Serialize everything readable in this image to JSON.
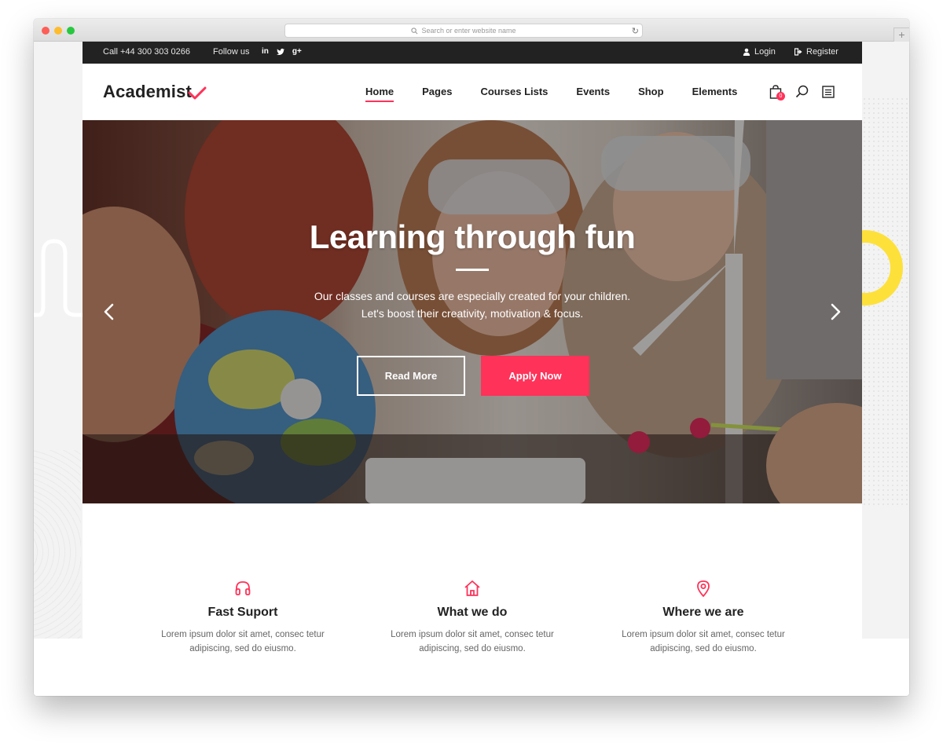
{
  "browser": {
    "url_placeholder": "Search or enter website name",
    "new_tab_label": "+"
  },
  "topbar": {
    "phone": "Call +44 300 303 0266",
    "follow_label": "Follow us",
    "social": [
      "in",
      "▸",
      "g+"
    ],
    "login": "Login",
    "register": "Register"
  },
  "header": {
    "logo": "Academist",
    "nav": [
      {
        "label": "Home",
        "active": true
      },
      {
        "label": "Pages",
        "active": false
      },
      {
        "label": "Courses Lists",
        "active": false
      },
      {
        "label": "Events",
        "active": false
      },
      {
        "label": "Shop",
        "active": false
      },
      {
        "label": "Elements",
        "active": false
      }
    ],
    "cart_count": "0",
    "icons": [
      "shopping-bag-icon",
      "search-icon",
      "menu-icon"
    ]
  },
  "hero": {
    "title": "Learning through fun",
    "subtitle": "Our classes and courses are especially created for your children. Let's boost their creativity, motivation & focus.",
    "read_more": "Read More",
    "apply_now": "Apply Now"
  },
  "features": [
    {
      "icon": "headphones-icon",
      "title": "Fast Suport",
      "text": "Lorem ipsum dolor sit amet, consec tetur adipiscing, sed do eiusmo."
    },
    {
      "icon": "home-icon",
      "title": "What we do",
      "text": "Lorem ipsum dolor sit amet, consec tetur adipiscing, sed do eiusmo."
    },
    {
      "icon": "map-pin-icon",
      "title": "Where we are",
      "text": "Lorem ipsum dolor sit amet, consec tetur adipiscing, sed do eiusmo."
    }
  ],
  "colors": {
    "accent": "#ff3259",
    "topbar_bg": "#222222",
    "text_dark": "#222222",
    "deco_yellow": "#fde13a"
  }
}
